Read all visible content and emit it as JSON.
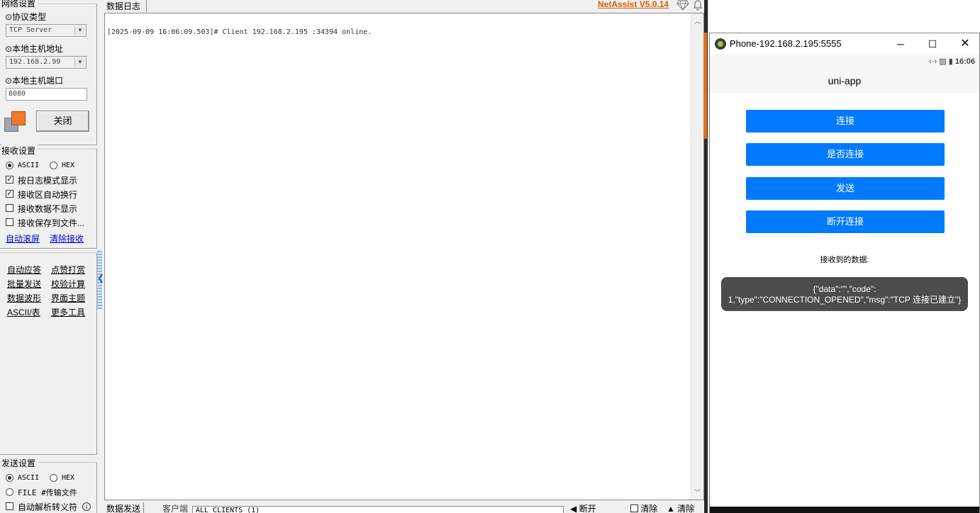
{
  "sidebar": {
    "network_group_title": "网络设置",
    "protocol_label": "⊙协议类型",
    "protocol_value": "TCP Server",
    "host_label": "⊙本地主机地址",
    "host_value": "192.168.2.99",
    "port_label": "⊙本地主机端口",
    "port_value": "8080",
    "close_button": "关闭",
    "receive_group_title": "接收设置",
    "recv_ascii": "ASCII",
    "recv_hex": "HEX",
    "recv_options": [
      "按日志模式显示",
      "接收区自动换行",
      "接收数据不显示",
      "接收保存到文件..."
    ],
    "recv_options_checked": [
      true,
      true,
      false,
      false
    ],
    "link_autoscroll": "自动滚屏",
    "link_clear": "清除接收",
    "tools": [
      "自动应答",
      "点赞打赏",
      "批量发送",
      "校验计算",
      "数据波形",
      "界面主题",
      "ASCII/表",
      "更多工具"
    ],
    "send_group_title": "发送设置",
    "send_ascii": "ASCII",
    "send_hex": "HEX",
    "send_file": "FILE #传输文件",
    "send_parse": "自动解析转义符"
  },
  "log": {
    "tab_label": "数据日志",
    "brand": "NetAssist V5.0.14",
    "line": "[2025-09-09 16:06:09.503]# Client 192.168.2.195 :34394 online."
  },
  "bottom": {
    "tab_label": "数据发送",
    "client_label": "客户端",
    "client_value": "ALL CLIENTS (1)",
    "disconnect": "断开",
    "clear1": "清除",
    "clear2": "清除"
  },
  "phone": {
    "window_title": "Phone-192.168.2.195:5555",
    "status_time": "16:06",
    "app_title": "uni-app",
    "buttons": [
      "连接",
      "是否连接",
      "发送",
      "断开连接"
    ],
    "recv_label": "接收到的数据:",
    "recv_line1": "{\"data\":\"\",\"code\":",
    "recv_line2": "1,\"type\":\"CONNECTION_OPENED\",\"msg\":\"TCP 连接已建立\"}",
    "accent": "#007aff"
  }
}
